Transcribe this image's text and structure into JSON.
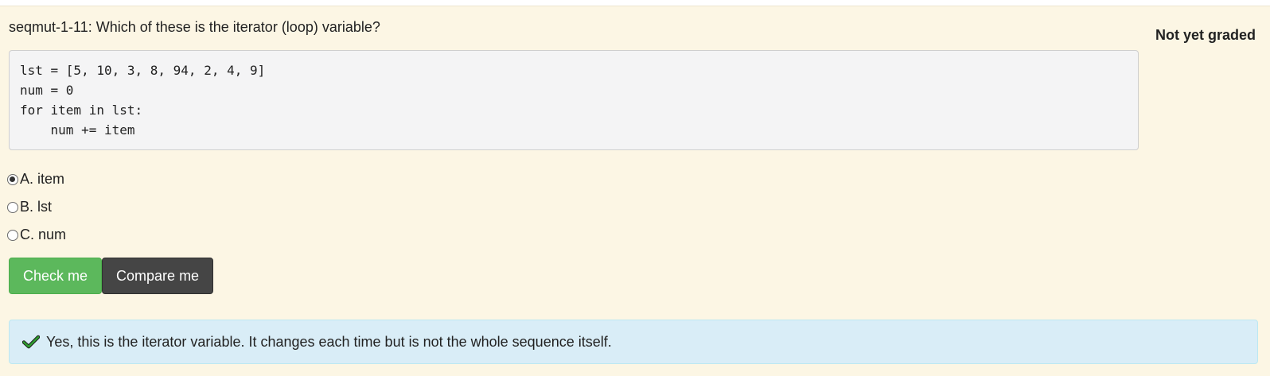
{
  "question": {
    "title": "seqmut-1-11: Which of these is the iterator (loop) variable?",
    "grade_status": "Not yet graded"
  },
  "code": {
    "lines": [
      "lst = [5, 10, 3, 8, 94, 2, 4, 9]",
      "num = 0",
      "for item in lst:",
      "    num += item"
    ]
  },
  "options": [
    {
      "label": "A. item",
      "selected": true
    },
    {
      "label": "B. lst",
      "selected": false
    },
    {
      "label": "C. num",
      "selected": false
    }
  ],
  "buttons": {
    "check_label": "Check me",
    "compare_label": "Compare me"
  },
  "feedback": {
    "icon": "checkmark-icon",
    "text": "Yes, this is the iterator variable. It changes each time but is not the whole sequence itself."
  },
  "colors": {
    "card_background": "#fcf6e4",
    "check_button": "#5cb85c",
    "compare_button": "#454545",
    "feedback_background": "#d9edf7",
    "checkmark": "#2e9e2e"
  }
}
